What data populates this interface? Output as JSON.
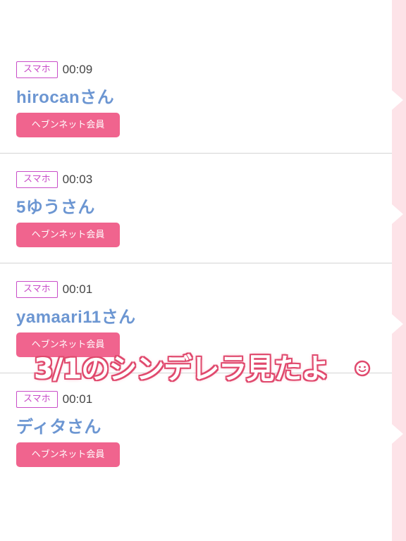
{
  "visitors": [
    {
      "device": "スマホ",
      "time": "00:09",
      "name": "hirocanさん",
      "badge": "ヘブンネット会員"
    },
    {
      "device": "スマホ",
      "time": "00:03",
      "name": "5ゆうさん",
      "badge": "ヘブンネット会員"
    },
    {
      "device": "スマホ",
      "time": "00:01",
      "name": "yamaari11さん",
      "badge": "ヘブンネット会員"
    },
    {
      "device": "スマホ",
      "time": "00:01",
      "name": "ディタさん",
      "badge": "ヘブンネット会員"
    }
  ],
  "overlay": {
    "caption": "3/1のシンデレラ見たよ",
    "emoji": "smile-icon"
  },
  "colors": {
    "device_tag": "#c94dc8",
    "name": "#6c96d2",
    "badge_bg": "#f0648e",
    "caption_outline": "#e04a6e",
    "side_strip": "#fde3e8"
  }
}
